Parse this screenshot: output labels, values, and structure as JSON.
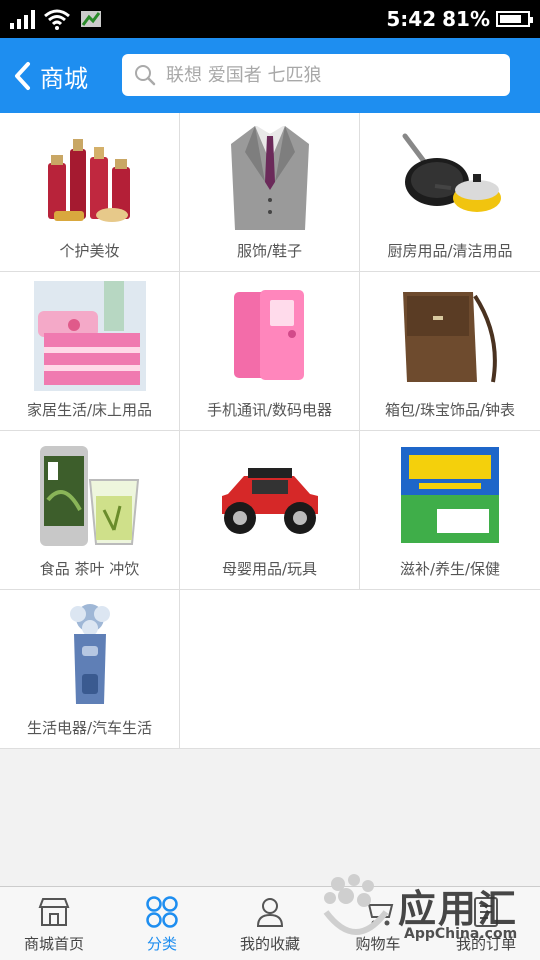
{
  "status_bar": {
    "time": "5:42",
    "battery_percent": "81%",
    "battery_level": 0.81
  },
  "header": {
    "back_label": "商城",
    "search_placeholder": "联想 爱国者 七匹狼"
  },
  "categories": [
    {
      "label": "个护美妆",
      "icon": "cosmetics-image"
    },
    {
      "label": "服饰/鞋子",
      "icon": "suit-image"
    },
    {
      "label": "厨房用品/清洁用品",
      "icon": "cookware-image"
    },
    {
      "label": "家居生活/床上用品",
      "icon": "bedding-image"
    },
    {
      "label": "手机通讯/数码电器",
      "icon": "phone-image"
    },
    {
      "label": "箱包/珠宝饰品/钟表",
      "icon": "bag-image"
    },
    {
      "label": "食品 茶叶 冲饮",
      "icon": "tea-image"
    },
    {
      "label": "母婴用品/玩具",
      "icon": "toy-car-image"
    },
    {
      "label": "滋补/养生/保健",
      "icon": "health-box-image"
    },
    {
      "label": "生活电器/汽车生活",
      "icon": "shaver-image"
    }
  ],
  "tabs": [
    {
      "label": "商城首页",
      "icon": "store-icon",
      "active": false
    },
    {
      "label": "分类",
      "icon": "category-icon",
      "active": true
    },
    {
      "label": "我的收藏",
      "icon": "favorites-icon",
      "active": false
    },
    {
      "label": "购物车",
      "icon": "cart-icon",
      "active": false
    },
    {
      "label": "我的订单",
      "icon": "orders-icon",
      "active": false
    }
  ],
  "watermark": {
    "text": "应用汇",
    "url": "AppChina.com"
  },
  "colors": {
    "accent": "#1e8ef0",
    "statusbar": "#000000"
  }
}
